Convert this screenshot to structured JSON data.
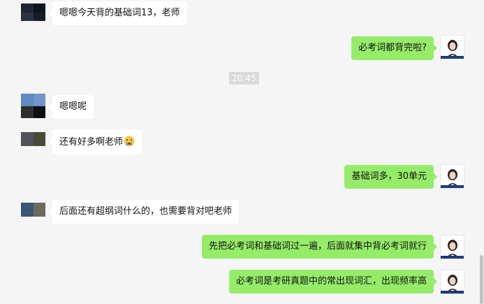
{
  "messages": [
    {
      "side": "in",
      "text": "嗯嗯今天背的基础词13，老师"
    },
    {
      "side": "out",
      "text": "必考词都背完啦?"
    },
    {
      "side": "time",
      "text": "20:45"
    },
    {
      "side": "in",
      "text": "嗯嗯呢"
    },
    {
      "side": "in",
      "text": "还有好多啊老师",
      "emoji": "crying-face-icon"
    },
    {
      "side": "out",
      "text": "基础词多，30单元"
    },
    {
      "side": "in",
      "text": "后面还有超纲词什么的，也需要背对吧老师"
    },
    {
      "side": "out",
      "text": "先把必考词和基础词过一遍，后面就集中背必考词就行"
    },
    {
      "side": "out",
      "text": "必考词是考研真题中的常出现词汇，出现频率高"
    }
  ],
  "colors": {
    "background": "#f5f5f5",
    "incoming_bubble": "#ffffff",
    "outgoing_bubble": "#95ec69",
    "time_badge": "#dadada"
  }
}
